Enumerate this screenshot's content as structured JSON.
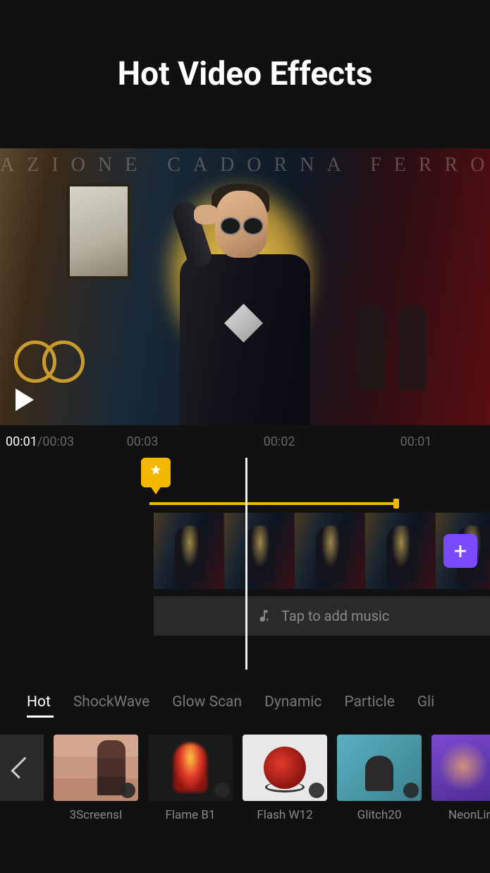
{
  "header": {
    "title": "Hot Video Effects"
  },
  "preview": {
    "bg_text": "AZIONE CADORNA FERROVIE"
  },
  "timecodes": {
    "current": "00:01",
    "total": "/00:03",
    "ticks": [
      "00:03",
      "00:02",
      "00:01"
    ]
  },
  "music": {
    "label": "Tap to add music"
  },
  "categories": [
    {
      "label": "Hot",
      "active": true
    },
    {
      "label": "ShockWave",
      "active": false
    },
    {
      "label": "Glow Scan",
      "active": false
    },
    {
      "label": "Dynamic",
      "active": false
    },
    {
      "label": "Particle",
      "active": false
    },
    {
      "label": "Gli",
      "active": false
    }
  ],
  "effects": [
    {
      "label": "3ScreensI"
    },
    {
      "label": "Flame B1"
    },
    {
      "label": "Flash W12"
    },
    {
      "label": "Glitch20"
    },
    {
      "label": "NeonLine"
    }
  ]
}
